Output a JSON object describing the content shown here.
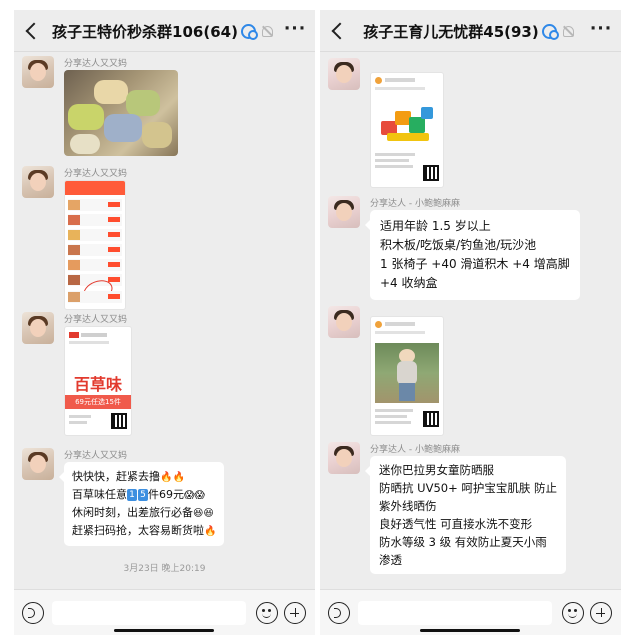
{
  "left_chat": {
    "title": "孩子王特价秒杀群106(64)",
    "sender_name": "分享达人又又妈",
    "poster": {
      "brand": "百草味",
      "promo": "69元任选15件"
    },
    "text_message": {
      "line1": "快快快，赶紧去撸",
      "line2_prefix": "百草味任意",
      "line2_num1": "1",
      "line2_num2": "5",
      "line2_suffix": "件69元",
      "line3": "休闲时刻，出差旅行必备",
      "line4": "赶紧扫码抢，太容易断货啦"
    },
    "timestamp": "3月23日 晚上20:19"
  },
  "right_chat": {
    "title": "孩子王育儿无忧群45(93)",
    "sender_name": "分享达人 - 小鲍鲍麻麻",
    "message1": {
      "line1": "适用年龄 1.5 岁以上",
      "line2": "积木板/吃饭桌/钓鱼池/玩沙池",
      "line3": "1 张椅子 +40 滑道积木 +4 增高脚",
      "line4": "+4 收纳盒"
    },
    "message2": {
      "line1": "迷你巴拉男女童防晒服",
      "line2": "防晒抗 UV50+ 呵护宝宝肌肤 防止",
      "line3": "紫外线晒伤",
      "line4": "良好透气性 可直接水洗不变形",
      "line5": "防水等级 3 级  有效防止夏天小雨",
      "line6": "渗透"
    }
  },
  "icons": {
    "back": "chevron-left-icon",
    "group": "group-chat-icon",
    "mute": "mute-bell-icon",
    "more": "more-dots-icon",
    "voice": "voice-icon",
    "emoji": "emoji-icon",
    "plus": "plus-icon"
  },
  "colors": {
    "chat_bg": "#ededed",
    "bubble_bg": "#ffffff",
    "accent_blue": "#2f88e8",
    "brand_red": "#e23a2e"
  }
}
